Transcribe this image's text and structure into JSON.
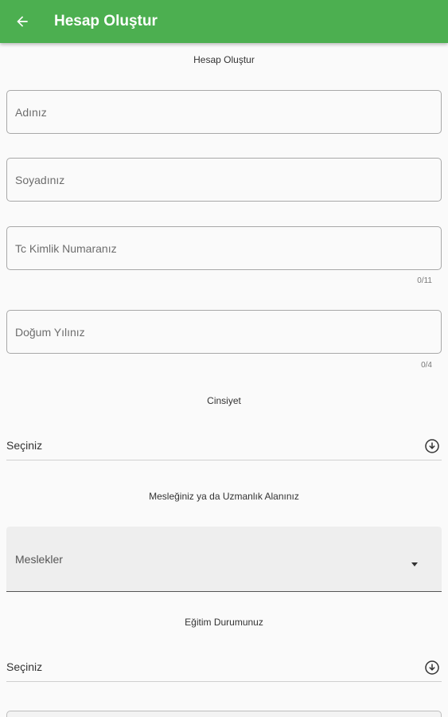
{
  "appbar": {
    "title": "Hesap Oluştur",
    "back_icon": "arrow-left-icon",
    "color": "#4caf50"
  },
  "form": {
    "heading": "Hesap Oluştur",
    "first_name": {
      "placeholder": "Adınız",
      "value": ""
    },
    "last_name": {
      "placeholder": "Soyadınız",
      "value": ""
    },
    "tc_number": {
      "placeholder": "Tc Kimlik Numaranız",
      "value": "",
      "counter": "0/11"
    },
    "birth_year": {
      "placeholder": "Doğum Yılınız",
      "value": "",
      "counter": "0/4"
    },
    "gender": {
      "label": "Cinsiyet",
      "selected": "Seçiniz",
      "icon": "circle-arrow-down-icon"
    },
    "profession": {
      "label": "Mesleğiniz ya da Uzmanlık Alanınız",
      "selected": "Meslekler",
      "icon": "caret-down-icon"
    },
    "education": {
      "label": "Eğitim Durumunuz",
      "selected": "Seçiniz",
      "icon": "circle-arrow-down-icon"
    }
  }
}
